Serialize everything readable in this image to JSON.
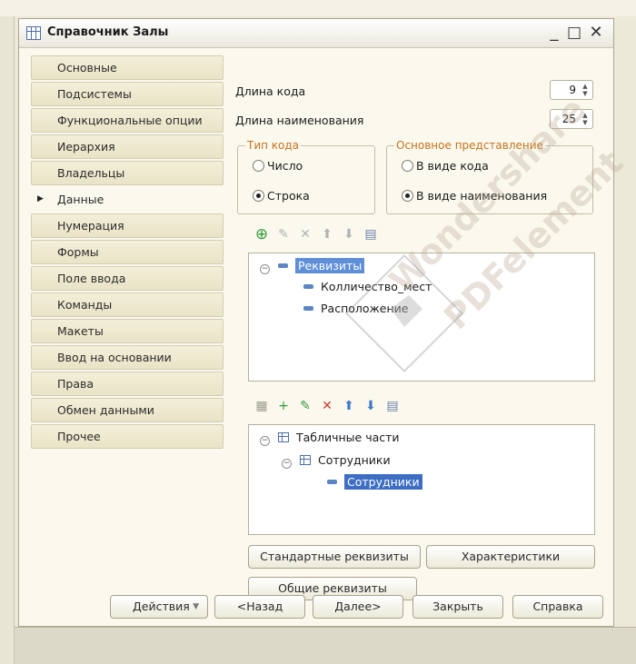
{
  "window": {
    "title": "Справочник Залы",
    "minimize": "_",
    "maximize": "□",
    "close": "✕"
  },
  "tabs": [
    {
      "label": "Основные"
    },
    {
      "label": "Подсистемы"
    },
    {
      "label": "Функциональные опции"
    },
    {
      "label": "Иерархия"
    },
    {
      "label": "Владельцы"
    },
    {
      "label": "Данные",
      "active": true
    },
    {
      "label": "Нумерация"
    },
    {
      "label": "Формы"
    },
    {
      "label": "Поле ввода"
    },
    {
      "label": "Команды"
    },
    {
      "label": "Макеты"
    },
    {
      "label": "Ввод на основании"
    },
    {
      "label": "Права"
    },
    {
      "label": "Обмен данными"
    },
    {
      "label": "Прочее"
    }
  ],
  "form": {
    "code_length_label": "Длина кода",
    "code_length_value": "9",
    "name_length_label": "Длина наименования",
    "name_length_value": "25",
    "code_type": {
      "title": "Тип кода",
      "options": [
        "Число",
        "Строка"
      ],
      "selected": "Строка"
    },
    "main_presentation": {
      "title": "Основное представление",
      "options": [
        "В виде кода",
        "В виде наименования"
      ],
      "selected": "В виде наименования"
    }
  },
  "attributes_tree": {
    "root": "Реквизиты",
    "children": [
      "Колличество_мест",
      "Расположение"
    ]
  },
  "tabular_tree": {
    "root": "Табличные части",
    "child": "Сотрудники",
    "grandchild": "Сотрудники"
  },
  "buttons": {
    "standard_attributes": "Стандартные реквизиты",
    "characteristics": "Характеристики",
    "common_attributes": "Общие реквизиты",
    "actions": "Действия",
    "back": "<Назад",
    "next": "Далее>",
    "close": "Закрыть",
    "help": "Справка"
  },
  "watermark": {
    "line1": "Wondershare",
    "line2": "PDFelement"
  },
  "colors": {
    "accent": "#3d6ec4",
    "group_title": "#c5721c",
    "window_bg": "#fbf9ee"
  }
}
